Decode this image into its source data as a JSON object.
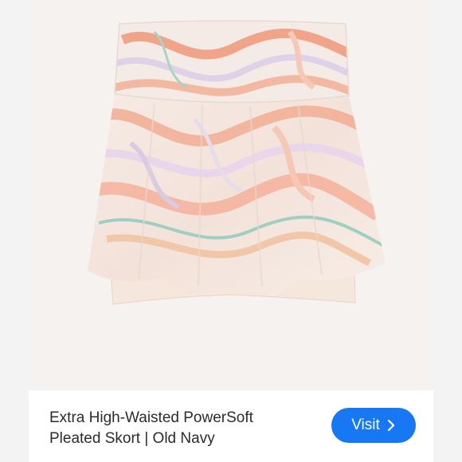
{
  "product": {
    "image_subject": "skort-photo",
    "title": "Extra High-Waisted PowerSoft\nPleated Skort | Old Navy"
  },
  "cta": {
    "label": "Visit",
    "icon": "chevron-right-icon",
    "color": "#1877f2"
  }
}
